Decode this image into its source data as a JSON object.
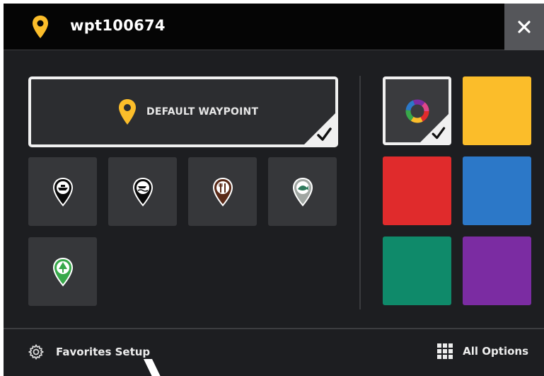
{
  "header": {
    "title": "wpt100674",
    "icon": "waypoint-pin-icon",
    "close_icon": "close-icon"
  },
  "icon_picker": {
    "default_option": {
      "label": "DEFAULT WAYPOINT",
      "icon": "waypoint-pin-icon",
      "selected": true
    },
    "options": [
      {
        "icon": "boat-marker-icon"
      },
      {
        "icon": "boat-wake-marker-icon"
      },
      {
        "icon": "restaurant-marker-icon"
      },
      {
        "icon": "fish-marker-icon"
      },
      {
        "icon": "tree-marker-icon"
      }
    ]
  },
  "color_picker": {
    "options": [
      {
        "name": "multicolor",
        "color": "#3a3b3e",
        "selected": true
      },
      {
        "name": "yellow",
        "color": "#fbbd2a"
      },
      {
        "name": "red",
        "color": "#e02b2c"
      },
      {
        "name": "blue",
        "color": "#2c78c8"
      },
      {
        "name": "green",
        "color": "#0f8a6a"
      },
      {
        "name": "purple",
        "color": "#7b2ca2"
      }
    ]
  },
  "footer": {
    "favorites_label": "Favorites Setup",
    "favorites_icon": "gear-icon",
    "all_options_label": "All Options",
    "all_options_icon": "grid-icon"
  },
  "colors": {
    "background": "#1d1e21",
    "header_background": "#050505",
    "accent_yellow": "#fbbd2a",
    "tile": "#36373a"
  }
}
